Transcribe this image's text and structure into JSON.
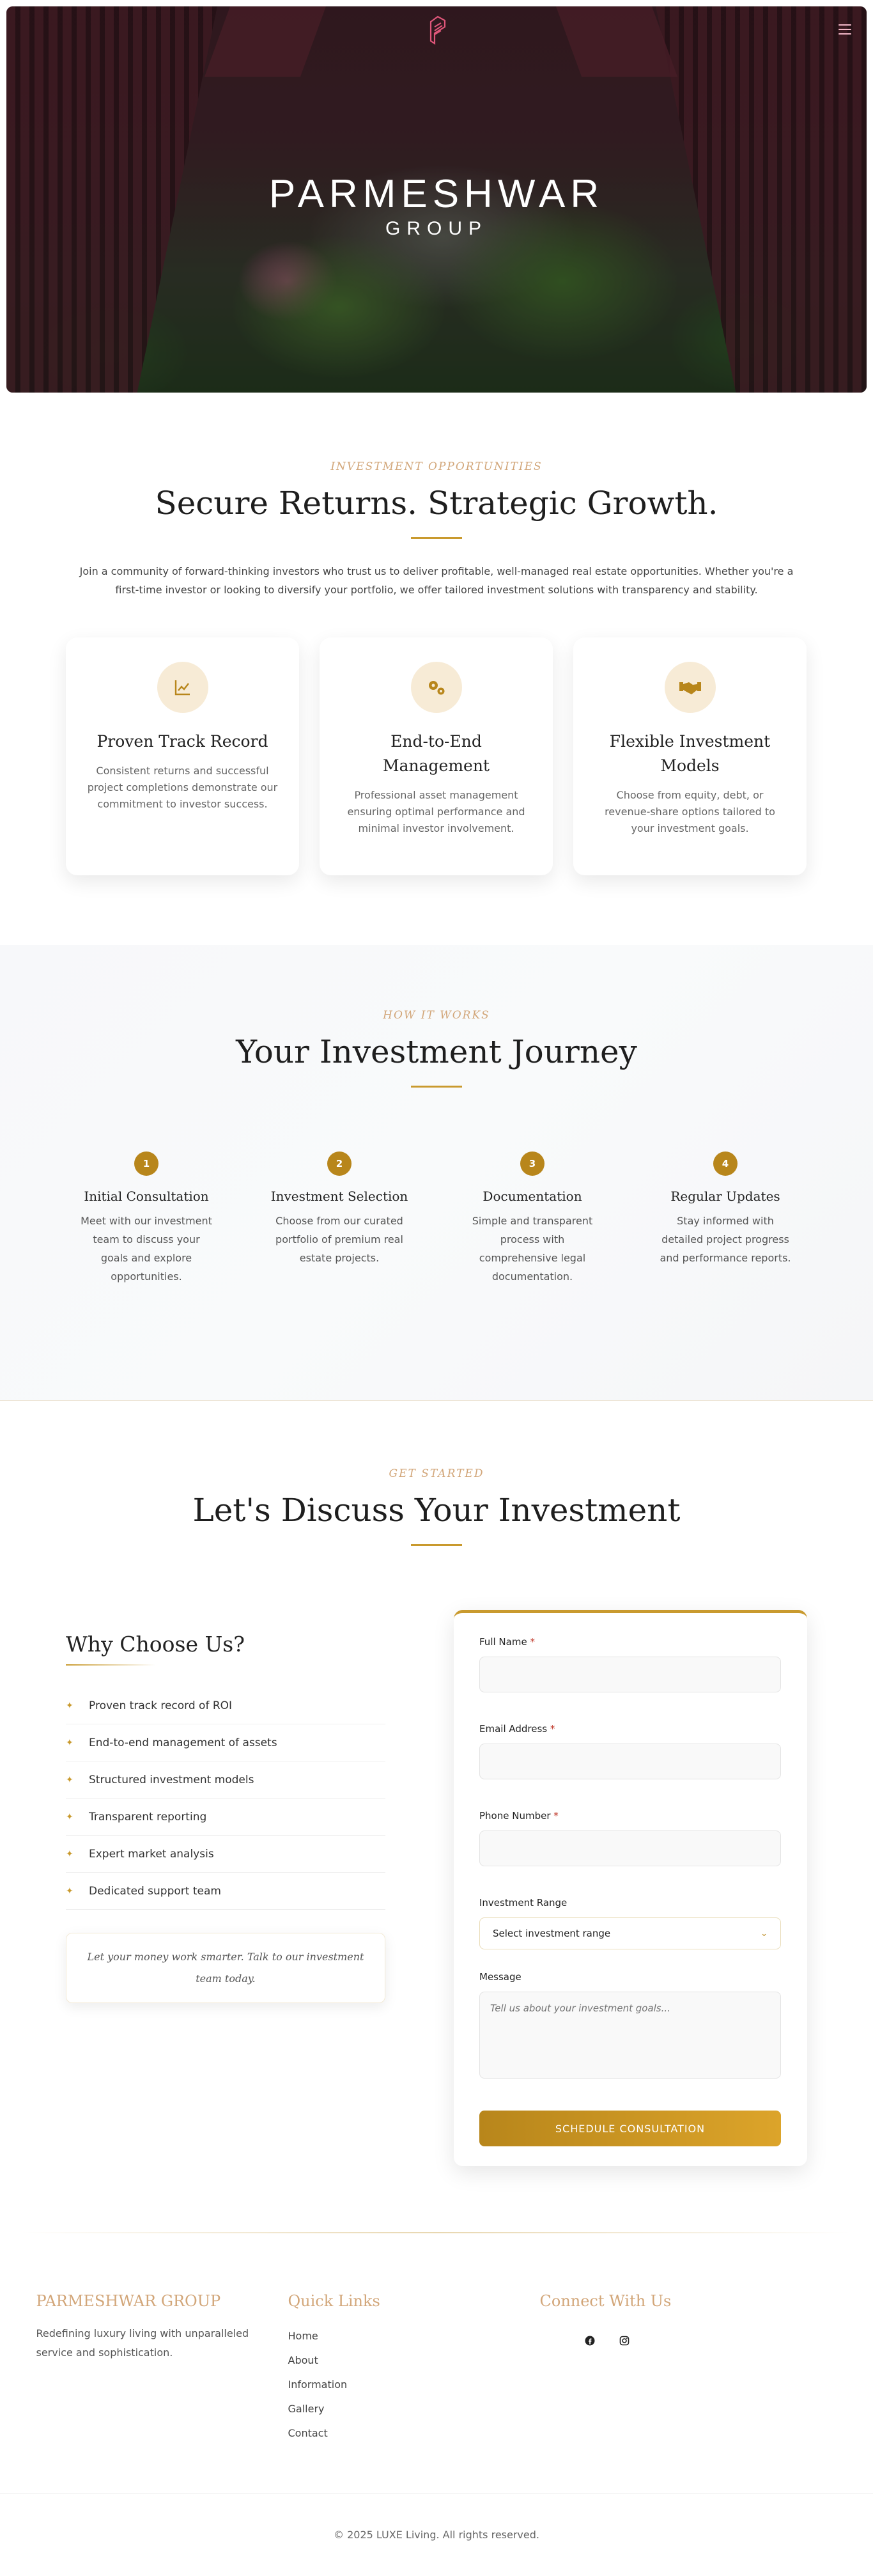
{
  "hero": {
    "brand_name": "PARMESHWAR",
    "brand_sub": "GROUP",
    "logo_icon": "parmeshwar-logo-mark",
    "menu_icon": "hamburger-menu-icon"
  },
  "opportunities": {
    "eyebrow": "INVESTMENT OPPORTUNITIES",
    "title": "Secure Returns. Strategic Growth.",
    "intro": "Join a community of forward-thinking investors who trust us to deliver profitable, well-managed real estate opportunities. Whether you're a first-time investor or looking to diversify your portfolio, we offer tailored investment solutions with transparency and stability.",
    "cards": [
      {
        "icon": "chart-line-icon",
        "title": "Proven Track Record",
        "text": "Consistent returns and successful project completions demonstrate our commitment to investor success."
      },
      {
        "icon": "gears-icon",
        "title": "End-to-End Management",
        "text": "Professional asset management ensuring optimal performance and minimal investor involvement."
      },
      {
        "icon": "handshake-icon",
        "title": "Flexible Investment Models",
        "text": "Choose from equity, debt, or revenue-share options tailored to your investment goals."
      }
    ]
  },
  "journey": {
    "eyebrow": "HOW IT WORKS",
    "title": "Your Investment Journey",
    "steps": [
      {
        "num": "1",
        "title": "Initial Consultation",
        "text": "Meet with our investment team to discuss your goals and explore opportunities."
      },
      {
        "num": "2",
        "title": "Investment Selection",
        "text": "Choose from our curated portfolio of premium real estate projects."
      },
      {
        "num": "3",
        "title": "Documentation",
        "text": "Simple and transparent process with comprehensive legal documentation."
      },
      {
        "num": "4",
        "title": "Regular Updates",
        "text": "Stay informed with detailed project progress and performance reports."
      }
    ]
  },
  "contact": {
    "eyebrow": "GET STARTED",
    "title": "Let's Discuss Your Investment",
    "why_title": "Why Choose Us?",
    "why_items": [
      "Proven track record of ROI",
      "End-to-end management of assets",
      "Structured investment models",
      "Transparent reporting",
      "Expert market analysis",
      "Dedicated support team"
    ],
    "quote": "Let your money work smarter. Talk to our investment team today.",
    "form": {
      "full_name_label": "Full Name",
      "email_label": "Email Address",
      "phone_label": "Phone Number",
      "required_mark": "*",
      "range_label": "Investment Range",
      "range_value": "Select investment range",
      "message_label": "Message",
      "message_placeholder": "Tell us about your investment goals...",
      "submit_label": "SCHEDULE CONSULTATION"
    }
  },
  "footer": {
    "brand_title": "PARMESHWAR GROUP",
    "brand_desc": "Redefining luxury living with unparalleled service and sophistication.",
    "links_title": "Quick Links",
    "links": [
      "Home",
      "About",
      "Information",
      "Gallery",
      "Contact"
    ],
    "connect_title": "Connect With Us",
    "socials": [
      "facebook-icon",
      "instagram-icon"
    ],
    "copyright": "© 2025 LUXE Living. All rights reserved."
  },
  "colors": {
    "accent_gold": "#c99a2e",
    "eyebrow_tan": "#d2a679",
    "icon_bg": "#f7ebd6",
    "required_red": "#c0392b"
  }
}
